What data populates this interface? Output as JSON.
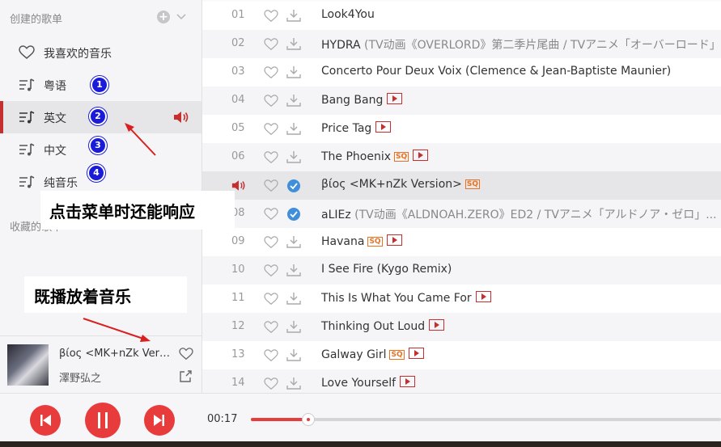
{
  "sidebar": {
    "created_header": "创建的歌单",
    "playlists": [
      {
        "label": "我喜欢的音乐",
        "icon": "heart-icon"
      },
      {
        "label": "粤语",
        "icon": "playlist-icon",
        "badge": "1"
      },
      {
        "label": "英文",
        "icon": "playlist-icon",
        "badge": "2",
        "active": true
      },
      {
        "label": "中文",
        "icon": "playlist-icon",
        "badge": "3"
      },
      {
        "label": "纯音乐",
        "icon": "playlist-icon",
        "badge": "4"
      }
    ],
    "favorites_header": "收藏的歌单"
  },
  "annotations": {
    "menu_callout": "点击菜单时还能响应",
    "playing_callout": "既播放着音乐"
  },
  "now_playing": {
    "title": "βίος <MK+nZk Version>",
    "artist": "澤野弘之"
  },
  "songs": [
    {
      "index": "01",
      "title": "Look4You",
      "sub": "",
      "sq": false,
      "mv": false,
      "downloaded": false
    },
    {
      "index": "02",
      "title": "HYDRA",
      "sub": "(TV动画《OVERLORD》第二季片尾曲 / TVアニメ「オーバーロード」...",
      "sq": false,
      "mv": false,
      "downloaded": false
    },
    {
      "index": "03",
      "title": "Concerto Pour Deux Voix (Clemence & Jean-Baptiste Maunier)",
      "sub": "",
      "sq": false,
      "mv": false,
      "downloaded": false
    },
    {
      "index": "04",
      "title": "Bang Bang",
      "sub": "",
      "sq": false,
      "mv": true,
      "downloaded": false
    },
    {
      "index": "05",
      "title": "Price Tag",
      "sub": "",
      "sq": false,
      "mv": true,
      "downloaded": false
    },
    {
      "index": "06",
      "title": "The Phoenix",
      "sub": "",
      "sq": true,
      "mv": true,
      "downloaded": false
    },
    {
      "index": "07",
      "title": "βίος <MK+nZk Version>",
      "sub": "",
      "sq": true,
      "mv": false,
      "downloaded": true,
      "current": true
    },
    {
      "index": "08",
      "title": "aLIEz",
      "sub": "(TV动画《ALDNOAH.ZERO》ED2 / TVアニメ「アルドノア・ゼロ」...",
      "sq": false,
      "mv": false,
      "downloaded": true
    },
    {
      "index": "09",
      "title": "Havana",
      "sub": "",
      "sq": true,
      "mv": true,
      "downloaded": false
    },
    {
      "index": "10",
      "title": "I See Fire (Kygo Remix)",
      "sub": "",
      "sq": false,
      "mv": false,
      "downloaded": false
    },
    {
      "index": "11",
      "title": "This Is What You Came For",
      "sub": "",
      "sq": false,
      "mv": true,
      "downloaded": false
    },
    {
      "index": "12",
      "title": "Thinking Out Loud",
      "sub": "",
      "sq": false,
      "mv": true,
      "downloaded": false
    },
    {
      "index": "13",
      "title": "Galway Girl",
      "sub": "",
      "sq": true,
      "mv": true,
      "downloaded": false
    },
    {
      "index": "14",
      "title": "Love Yourself",
      "sub": "",
      "sq": false,
      "mv": true,
      "downloaded": false
    }
  ],
  "player": {
    "elapsed": "00:17",
    "progress_fraction": 0.12
  },
  "colors": {
    "accent": "#c62f2f",
    "player_button": "#e83c3c",
    "badge": "#1a1ad9",
    "downloaded": "#3f8fd9",
    "sq": "#e87222"
  }
}
